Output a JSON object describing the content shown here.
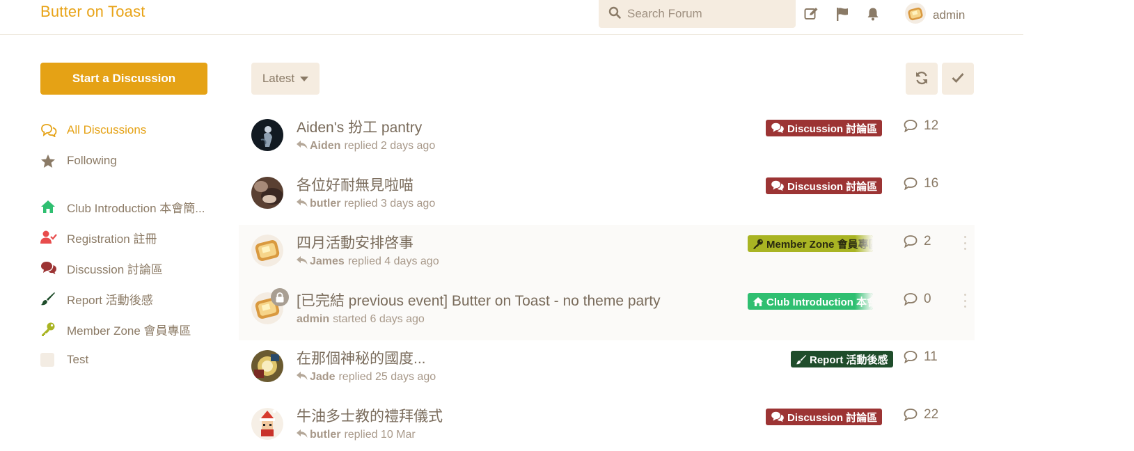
{
  "header": {
    "brand": "Butter on Toast",
    "search_placeholder": "Search Forum",
    "user_name": "admin"
  },
  "sidebar": {
    "start_button": "Start a Discussion",
    "nav": [
      {
        "label": "All Discussions",
        "icon": "comments-icon",
        "active": true
      },
      {
        "label": "Following",
        "icon": "star-icon"
      },
      {
        "label": "Club Introduction 本會簡...",
        "icon": "home-icon",
        "color": "#2fbf71"
      },
      {
        "label": "Registration 註冊",
        "icon": "user-check-icon",
        "color": "#e84c4c"
      },
      {
        "label": "Discussion 討論區",
        "icon": "comments-icon",
        "color": "#9c3434"
      },
      {
        "label": "Report 活動後感",
        "icon": "paintbrush-icon",
        "color": "#1f4d2b"
      },
      {
        "label": "Member Zone 會員專區",
        "icon": "key-icon",
        "color": "#a9b423"
      },
      {
        "label": "Test",
        "icon": "tag-swatch-icon",
        "color": "#f3ece3"
      }
    ]
  },
  "toolbar": {
    "sort_label": "Latest",
    "refresh_icon": "refresh-icon",
    "mark_read_icon": "check-icon"
  },
  "discussions": [
    {
      "title": "Aiden's 扮工 pantry",
      "user": "Aiden",
      "action": "replied 2 days ago",
      "tag": "Discussion 討論區",
      "tag_color": "#9c3434",
      "tag_icon": "comments-icon",
      "count": "12"
    },
    {
      "title": "各位好耐無見啦喵",
      "user": "butler",
      "action": "replied 3 days ago",
      "tag": "Discussion 討論區",
      "tag_color": "#9c3434",
      "tag_icon": "comments-icon",
      "count": "16"
    },
    {
      "title": "四月活動安排啓事",
      "user": "James",
      "action": "replied 4 days ago",
      "tag": "Member Zone 會員專區",
      "tag_color": "#a9b423",
      "tag_icon": "key-icon",
      "count": "2"
    },
    {
      "title": "[已完結 previous event] Butter on Toast - no theme party",
      "user": "admin",
      "action": "started 6 days ago",
      "tag": "Club Introduction 本會簡介",
      "tag_color": "#2fbf71",
      "tag_icon": "home-icon",
      "count": "0"
    },
    {
      "title": "在那個神秘的國度...",
      "user": "Jade",
      "action": "replied 25 days ago",
      "tag": "Report 活動後感",
      "tag_color": "#1f4d2b",
      "tag_icon": "paintbrush-icon",
      "count": "11"
    },
    {
      "title": "牛油多士教的禮拜儀式",
      "user": "butler",
      "action": "replied 10 Mar",
      "tag": "Discussion 討論區",
      "tag_color": "#9c3434",
      "tag_icon": "comments-icon",
      "count": "22"
    }
  ]
}
